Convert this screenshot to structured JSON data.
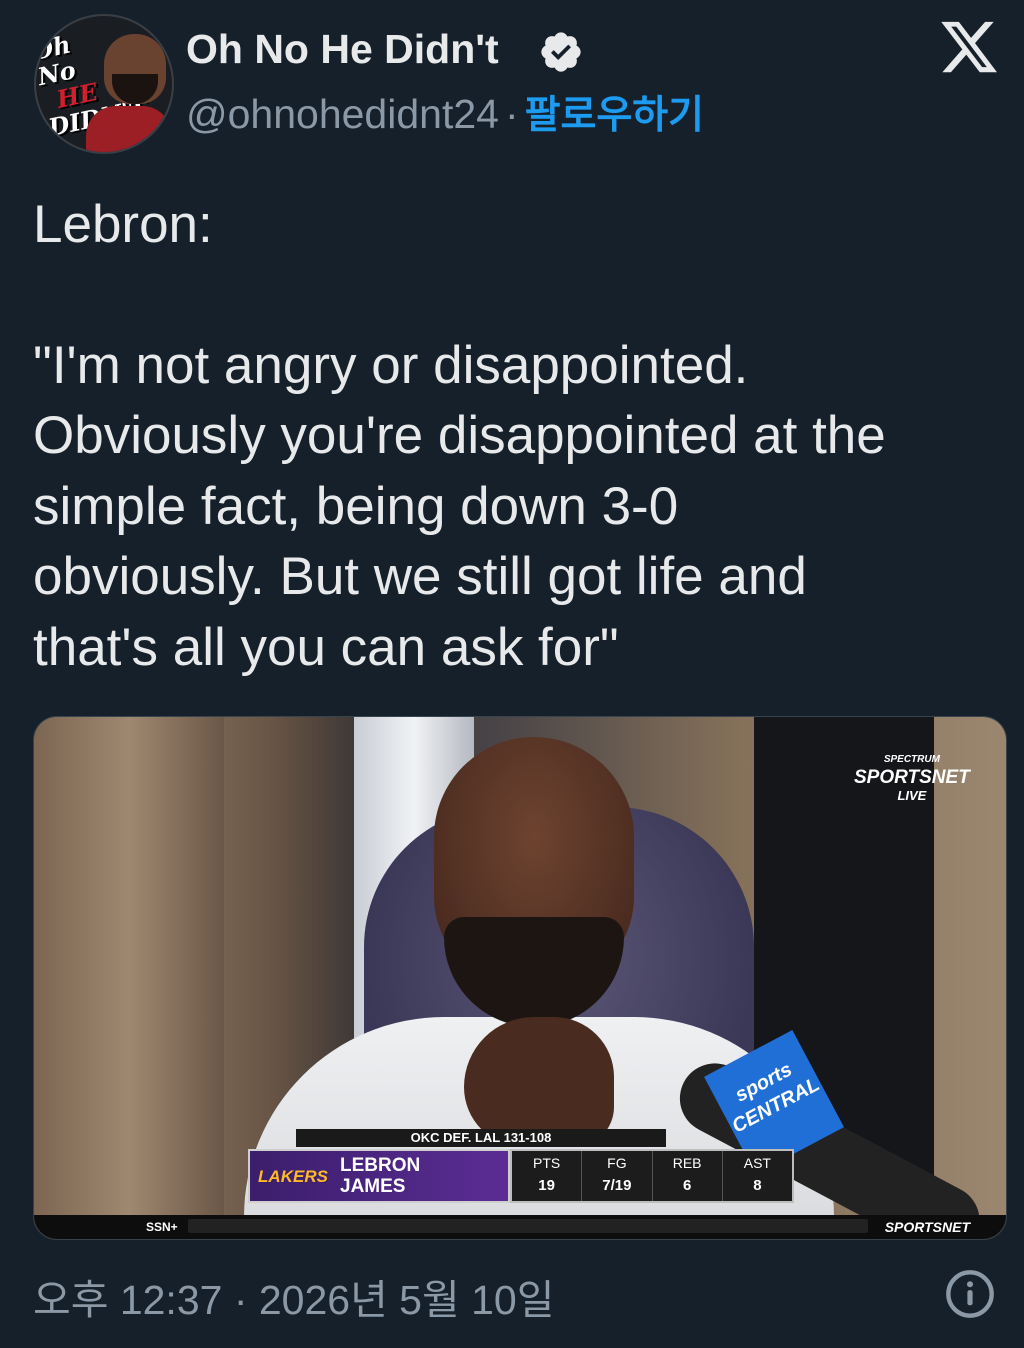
{
  "author": {
    "display_name": "Oh No He Didn't",
    "handle": "@ohnohedidnt24",
    "separator": "·",
    "follow_label": "팔로우하기",
    "avatar": {
      "line1": "Oh No",
      "line2": "HE",
      "line3": "DIDN'T"
    },
    "verified_icon": "verified-check-badge"
  },
  "platform_icon": "x-logo-icon",
  "tweet": {
    "line_intro": "Lebron:",
    "quote_lines": [
      "\"I'm not angry or disappointed.",
      "Obviously you're disappointed at the",
      "simple fact, being down 3-0",
      "obviously. But we still got life and",
      "that's all you can ask for\""
    ]
  },
  "media": {
    "broadcast_bug": {
      "line1": "SPECTRUM",
      "line2": "SPORTSNET",
      "line3": "LIVE"
    },
    "mic_flag": "sports CENTRAL",
    "game_line": "OKC DEF. LAL 131-108",
    "team_logo": "LAKERS",
    "player_first": "LEBRON",
    "player_last": "JAMES",
    "stats": [
      {
        "label": "PTS",
        "value": "19"
      },
      {
        "label": "FG",
        "value": "7/19"
      },
      {
        "label": "REB",
        "value": "6"
      },
      {
        "label": "AST",
        "value": "8"
      }
    ],
    "ticker_left": "SSN+",
    "ticker_right": "SPORTSNET"
  },
  "timestamp": "오후 12:37 · 2026년 5월 10일",
  "info_icon": "info-icon",
  "colors": {
    "background": "#15202b",
    "text": "#e7e9ea",
    "secondary": "#8b98a5",
    "accent": "#1d9bf0"
  }
}
